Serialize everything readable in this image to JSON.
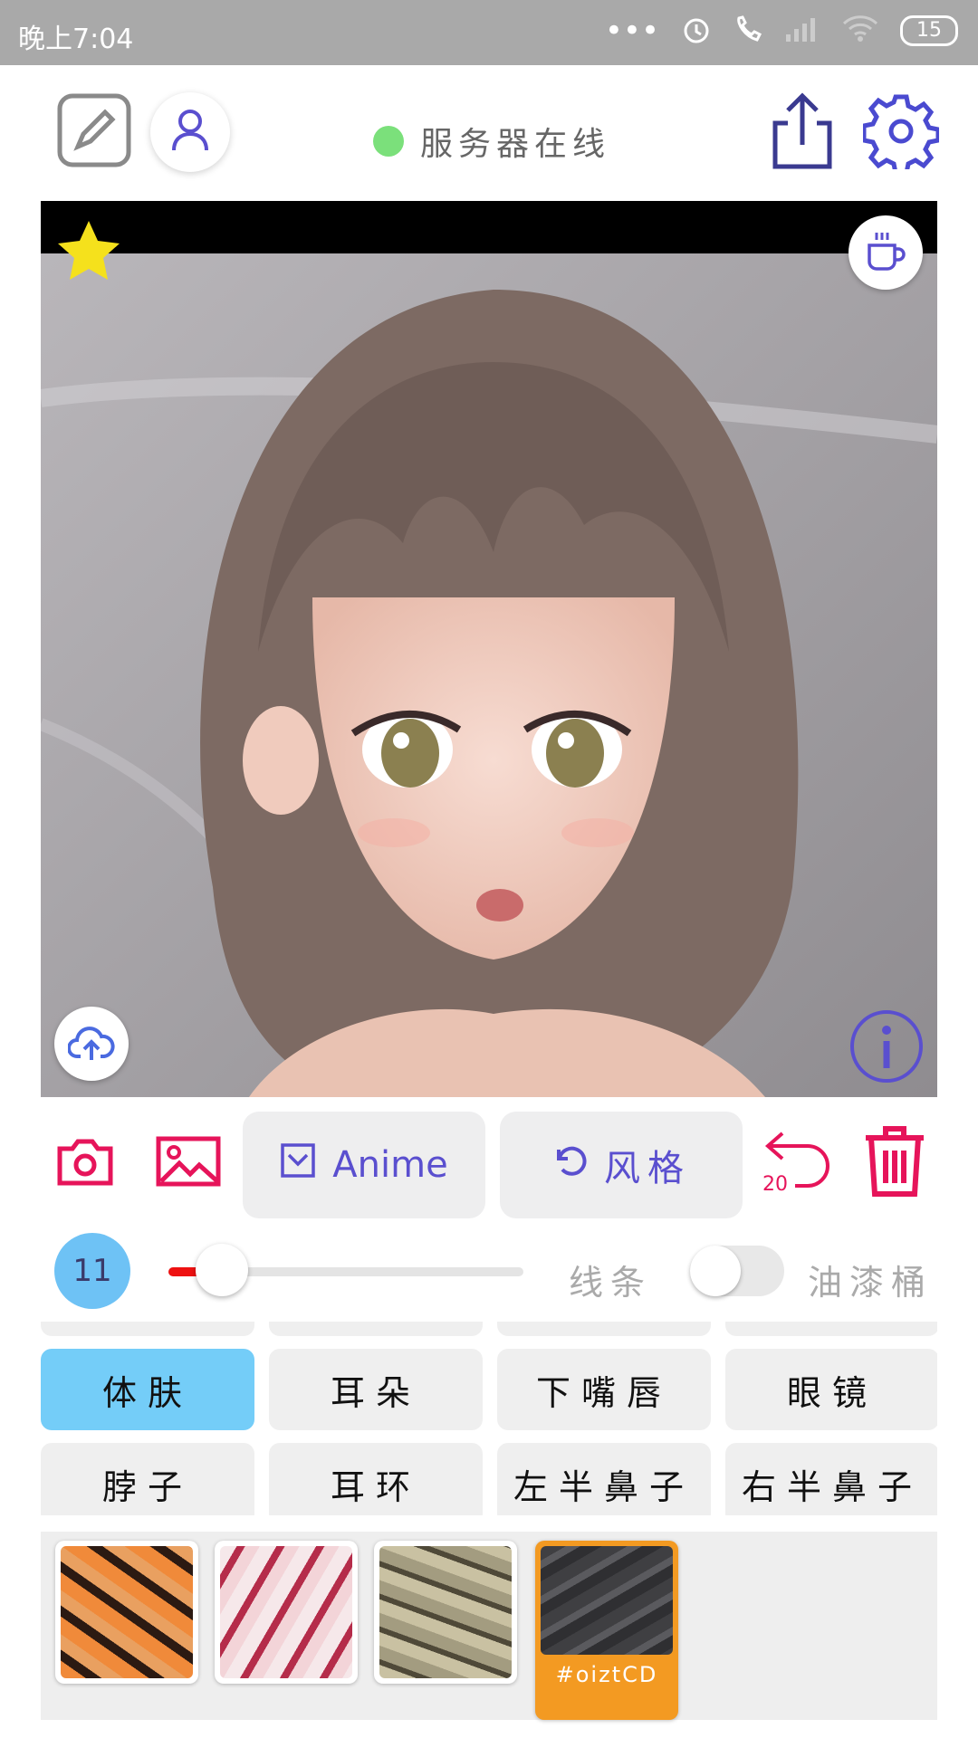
{
  "status_bar": {
    "time": "晚上7:04",
    "battery": "15"
  },
  "header": {
    "server_status": "服务器在线"
  },
  "colors": {
    "accent": "#5a4fcf",
    "primary_red": "#e6145a",
    "selected_part": "#74cdf8",
    "selected_texture": "#f39a22",
    "online": "#7be07b"
  },
  "toolbar": {
    "anime_label": "Anime",
    "style_label": "风格",
    "undo_count": "20"
  },
  "brush": {
    "size": "11",
    "line_label": "线条",
    "paint_label": "油漆桶",
    "size_fraction": 0.15,
    "paint_enabled": false
  },
  "parts": {
    "row1": [
      "体肤",
      "耳朵",
      "下嘴唇",
      "眼镜"
    ],
    "row2": [
      "脖子",
      "耳环",
      "左半鼻子",
      "右半鼻子"
    ],
    "selected": "体肤"
  },
  "textures": {
    "selected_caption": "#oiztCD"
  },
  "icons": [
    "edit-icon",
    "user-icon",
    "share-icon",
    "gear-icon",
    "star-icon",
    "coffee-icon",
    "upload-cloud-icon",
    "info-icon",
    "camera-icon",
    "image-icon",
    "checkbox-icon",
    "undo-icon",
    "trash-icon"
  ]
}
